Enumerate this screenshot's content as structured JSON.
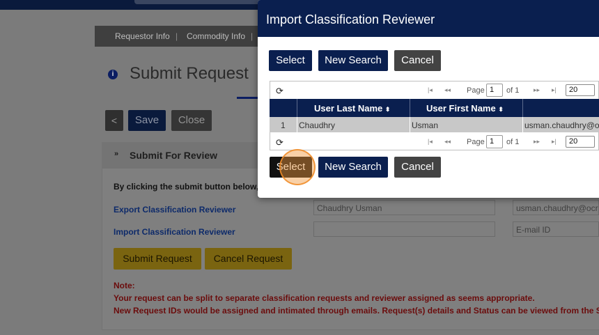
{
  "nav": {
    "items": [
      "Requestor Info",
      "Commodity Info"
    ],
    "separator": "|"
  },
  "page": {
    "title": "Submit Request",
    "info_icon": "i"
  },
  "toolbar": {
    "back_label": "<",
    "save_label": "Save",
    "close_label": "Close"
  },
  "section": {
    "title": "Submit For Review",
    "intro": "By clicking the submit button below,",
    "export_label": "Export Classification Reviewer",
    "import_label": "Import Classification Reviewer",
    "export_name_value": "Chaudhry Usman",
    "export_email_value": "usman.chaudhry@ocr",
    "import_name_value": "",
    "import_email_placeholder": "E-mail ID",
    "submit_label": "Submit Request",
    "cancel_label": "Cancel Request",
    "note_title": "Note:",
    "note_line1": "Your request can be split to separate classification requests and reviewer assigned as seems appropriate.",
    "note_line2": "New Request IDs would be assigned and intimated through emails. Request(s) details and Status can be viewed from the S"
  },
  "modal": {
    "title": "Import Classification Reviewer",
    "select_label": "Select",
    "new_search_label": "New Search",
    "cancel_label": "Cancel",
    "pager": {
      "refresh_icon": "⟳",
      "first_icon": "|◂",
      "prev_icon": "◂◂",
      "next_icon": "▸▸",
      "last_icon": "▸|",
      "page_label": "Page",
      "page_value": "1",
      "of_label": "of 1",
      "page_size": "20"
    },
    "columns": [
      "User Last Name",
      "User First Name"
    ],
    "sort_icon": "⬍",
    "rows": [
      {
        "index": "1",
        "last_name": "Chaudhry",
        "first_name": "Usman",
        "email": "usman.chaudhry@oc"
      }
    ]
  },
  "colors": {
    "navy": "#0a1f4f",
    "gold": "#7a6410",
    "note_red": "#6b0c0c",
    "highlight": "#f0963c"
  }
}
